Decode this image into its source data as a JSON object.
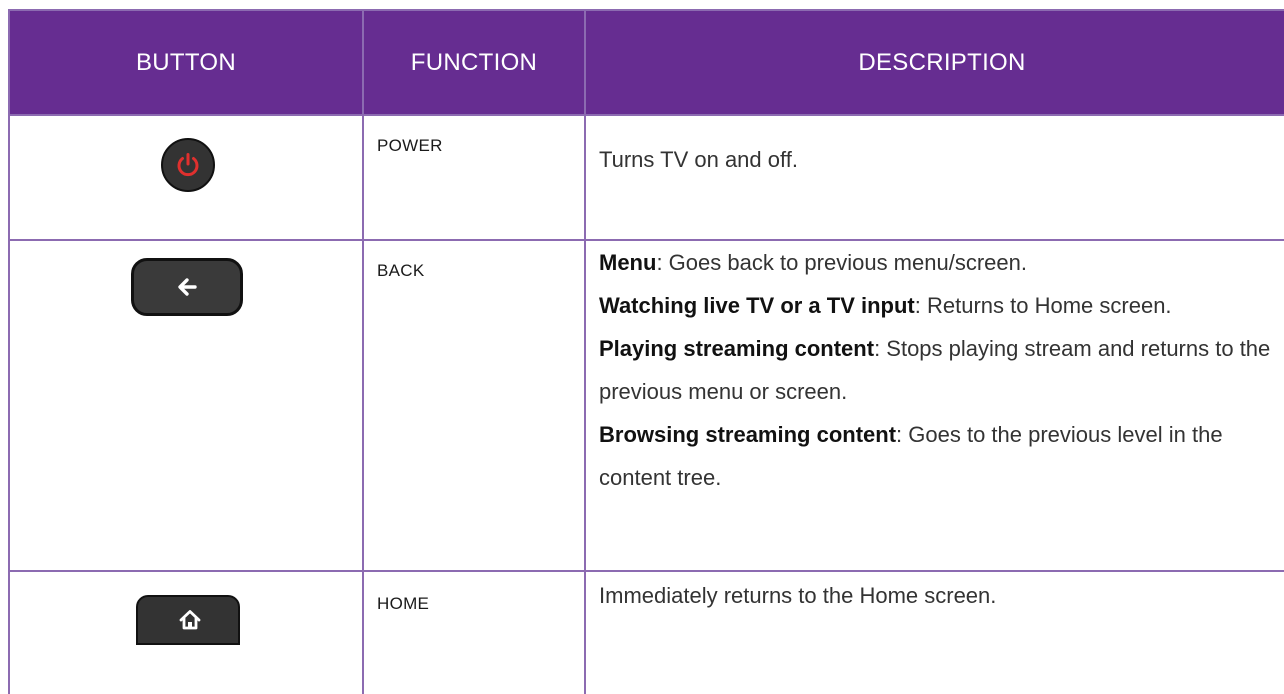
{
  "table": {
    "headers": [
      "BUTTON",
      "FUNCTION",
      "DESCRIPTION"
    ],
    "header_color": "#662d91",
    "border_color": "#8c6bb1",
    "rows": [
      {
        "button_icon": "power-icon",
        "function": "POWER",
        "description": [
          {
            "bold": "",
            "text": "Turns TV on and off."
          }
        ]
      },
      {
        "button_icon": "back-arrow-icon",
        "function": "BACK",
        "description": [
          {
            "bold": "Menu",
            "text": ": Goes back to previous menu/screen."
          },
          {
            "bold": "Watching live TV or a TV input",
            "text": ": Returns to Home screen."
          },
          {
            "bold": "Playing streaming content",
            "text": ": Stops playing stream and returns to the previous menu or screen."
          },
          {
            "bold": "Browsing streaming content",
            "text": ": Goes to the previous level in the content tree."
          }
        ]
      },
      {
        "button_icon": "home-icon",
        "function": "HOME",
        "description": [
          {
            "bold": "",
            "text": "Immediately returns to the Home screen."
          }
        ]
      }
    ]
  },
  "colors": {
    "power_icon": "#e0302e",
    "button_body": "#333333"
  }
}
